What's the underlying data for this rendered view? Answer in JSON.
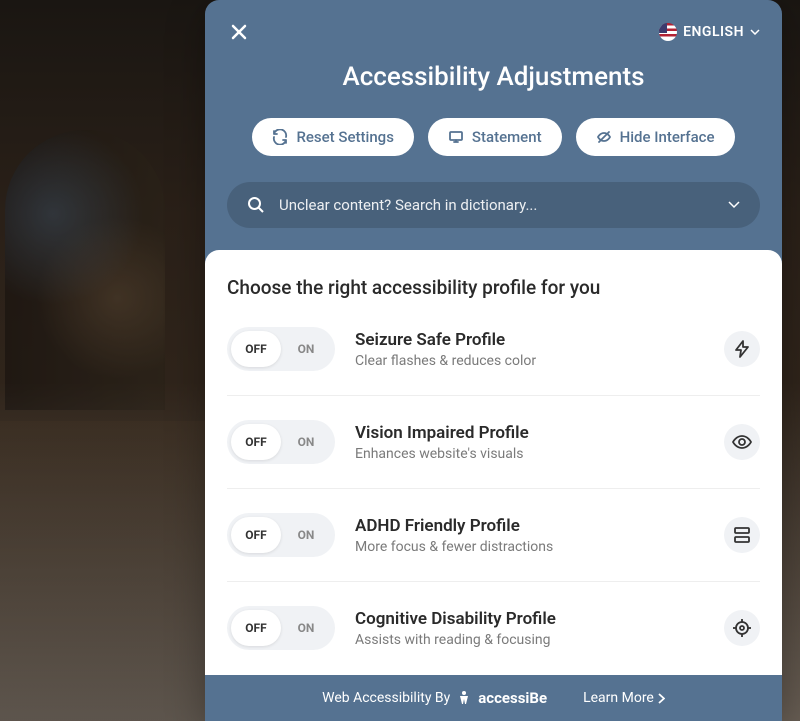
{
  "header": {
    "title": "Accessibility Adjustments",
    "language": "ENGLISH"
  },
  "actions": {
    "reset": "Reset Settings",
    "statement": "Statement",
    "hide": "Hide Interface"
  },
  "search": {
    "placeholder": "Unclear content? Search in dictionary..."
  },
  "profiles": {
    "section_title": "Choose the right accessibility profile for you",
    "off_label": "OFF",
    "on_label": "ON",
    "items": [
      {
        "title": "Seizure Safe Profile",
        "desc": "Clear flashes & reduces color",
        "icon": "bolt"
      },
      {
        "title": "Vision Impaired Profile",
        "desc": "Enhances website's visuals",
        "icon": "eye"
      },
      {
        "title": "ADHD Friendly Profile",
        "desc": "More focus & fewer distractions",
        "icon": "layout"
      },
      {
        "title": "Cognitive Disability Profile",
        "desc": "Assists with reading & focusing",
        "icon": "target"
      }
    ]
  },
  "footer": {
    "credit_prefix": "Web Accessibility By",
    "brand": "accessiBe",
    "learn_more": "Learn More"
  }
}
